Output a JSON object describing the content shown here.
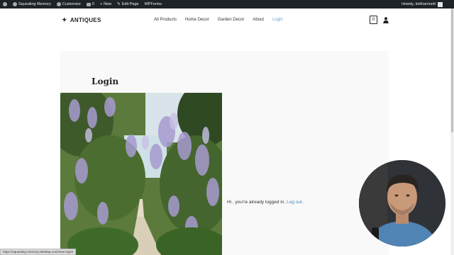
{
  "adminbar": {
    "site_name": "Squealing Memory",
    "customize": "Customize",
    "comments_count": "0",
    "new": "New",
    "edit_page": "Edit Page",
    "wpforms": "WPForms",
    "howdy": "Howdy, kirkhamnett"
  },
  "header": {
    "logo_text": "ANTIQUES",
    "nav": [
      "All Products",
      "Home Decor",
      "Garden Decor",
      "About",
      "Login"
    ],
    "active_nav": "Login",
    "cart_count": "0"
  },
  "main": {
    "title": "Login",
    "message_prefix": "Hi , you're already logged in.",
    "logout_link": "Log out",
    "message_suffix": "."
  },
  "status_url": "https://squealing-memory.sleekwp.com/new-login/",
  "colors": {
    "adminbar_bg": "#1d2327",
    "active_link": "#5aa7d6",
    "logout_link": "#3d8fbf"
  }
}
